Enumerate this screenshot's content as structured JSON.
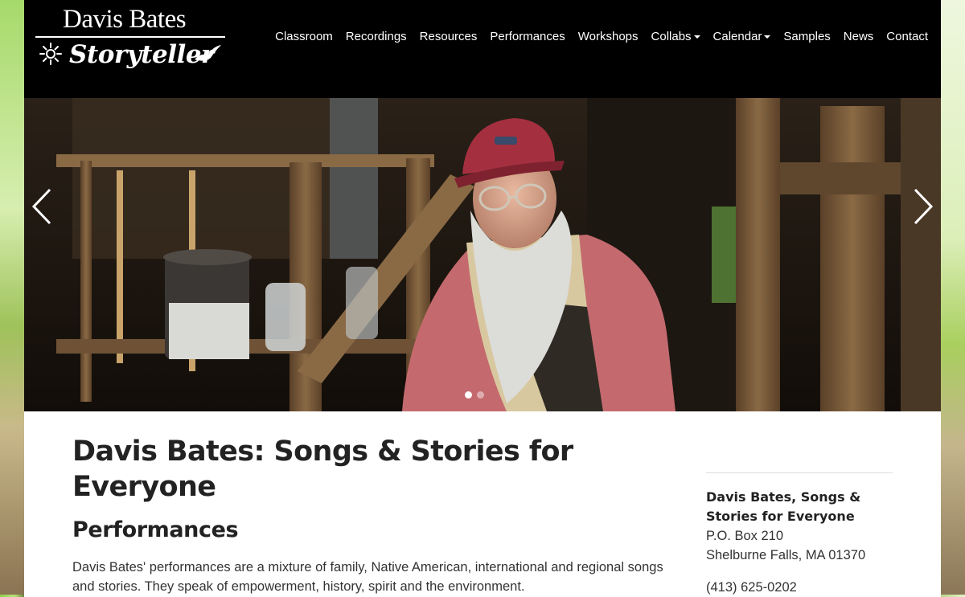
{
  "logo": {
    "line1": "Davis Bates",
    "line2": "Storyteller"
  },
  "nav": {
    "items": [
      {
        "label": "Classroom",
        "dropdown": false
      },
      {
        "label": "Recordings",
        "dropdown": false
      },
      {
        "label": "Resources",
        "dropdown": false
      },
      {
        "label": "Performances",
        "dropdown": false
      },
      {
        "label": "Workshops",
        "dropdown": false
      },
      {
        "label": "Collabs",
        "dropdown": true
      },
      {
        "label": "Calendar",
        "dropdown": true
      },
      {
        "label": "Samples",
        "dropdown": false
      },
      {
        "label": "News",
        "dropdown": false
      },
      {
        "label": "Contact",
        "dropdown": false
      }
    ]
  },
  "carousel": {
    "slide_count": 2,
    "active_index": 0
  },
  "main": {
    "title": "Davis Bates: Songs & Stories for Everyone",
    "subtitle": "Performances",
    "intro": "Davis Bates' performances are a mixture of family, Native American, international and regional songs and stories. They speak of empowerment, history, spirit and the environment."
  },
  "sidebar": {
    "name": "Davis Bates, Songs & Stories for Everyone",
    "address1": "P.O. Box 210",
    "address2": "Shelburne Falls, MA 01370",
    "phone": "(413) 625-0202"
  },
  "colors": {
    "header_bg": "#000000",
    "nav_text": "#ffffff",
    "heading": "#222222",
    "body_text": "#333333"
  }
}
